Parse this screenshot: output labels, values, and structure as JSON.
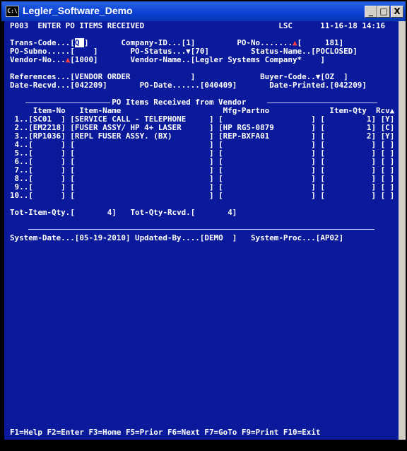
{
  "window": {
    "title": "Legler_Software_Demo",
    "icon_label": "C:\\",
    "buttons": {
      "minimize": "_",
      "maximize": "□",
      "close": "X"
    }
  },
  "header": {
    "program": "P003",
    "screen_title": "ENTER PO ITEMS RECEIVED",
    "company_code": "LSC",
    "date": "11-16-18",
    "time": "14:16"
  },
  "fields": {
    "trans_code": {
      "label": "Trans-Code...",
      "value": "Q"
    },
    "company_id": {
      "label": "Company-ID...",
      "value": "1"
    },
    "po_no": {
      "label": "PO-No........",
      "value": "181"
    },
    "po_subno": {
      "label": "PO-Subno.....",
      "value": ""
    },
    "po_status": {
      "label": "PO-Status...",
      "value": "70"
    },
    "status_name": {
      "label": "Status-Name..",
      "value": "POCLOSED"
    },
    "vendor_no": {
      "label": "Vendor-No...",
      "value": "1000"
    },
    "vendor_name": {
      "label": "Vendor-Name..",
      "value": "Legler Systems Company*"
    },
    "references": {
      "label": "References...",
      "value": "VENDOR ORDER"
    },
    "buyer_code": {
      "label": "Buyer-Code..",
      "value": "OZ"
    },
    "date_recvd": {
      "label": "Date-Recvd...",
      "value": "042209"
    },
    "po_date": {
      "label": "PO-Date......",
      "value": "040409"
    },
    "date_printed": {
      "label": "Date-Printed.",
      "value": "042209"
    }
  },
  "items_table": {
    "title": "PO Items Received from Vendor",
    "headers": {
      "item_no": "Item-No",
      "item_name": "Item-Name",
      "mfg_partno": "Mfg-Partno",
      "item_qty": "Item-Qty",
      "rcv": "Rcv"
    },
    "rows": [
      {
        "num": "1",
        "item_no": "SC01",
        "item_name": "SERVICE CALL - TELEPHONE",
        "mfg": "",
        "qty": "1",
        "rcv": "Y"
      },
      {
        "num": "2",
        "item_no": "EM2218",
        "item_name": "FUSER ASSY/ HP 4+ LASER",
        "mfg": "HP RG5-0879",
        "qty": "1",
        "rcv": "C"
      },
      {
        "num": "3",
        "item_no": "RP1036",
        "item_name": "REPL FUSER ASSY. (BX)",
        "mfg": "REP-BXFA01",
        "qty": "2",
        "rcv": "Y"
      },
      {
        "num": "4",
        "item_no": "",
        "item_name": "",
        "mfg": "",
        "qty": "",
        "rcv": ""
      },
      {
        "num": "5",
        "item_no": "",
        "item_name": "",
        "mfg": "",
        "qty": "",
        "rcv": ""
      },
      {
        "num": "6",
        "item_no": "",
        "item_name": "",
        "mfg": "",
        "qty": "",
        "rcv": ""
      },
      {
        "num": "7",
        "item_no": "",
        "item_name": "",
        "mfg": "",
        "qty": "",
        "rcv": ""
      },
      {
        "num": "8",
        "item_no": "",
        "item_name": "",
        "mfg": "",
        "qty": "",
        "rcv": ""
      },
      {
        "num": "9",
        "item_no": "",
        "item_name": "",
        "mfg": "",
        "qty": "",
        "rcv": ""
      },
      {
        "num": "10",
        "item_no": "",
        "item_name": "",
        "mfg": "",
        "qty": "",
        "rcv": ""
      }
    ]
  },
  "totals": {
    "tot_item_qty": {
      "label": "Tot-Item-Qty.",
      "value": "4"
    },
    "tot_qty_rcvd": {
      "label": "Tot-Qty-Rcvd.",
      "value": "4"
    }
  },
  "footer_fields": {
    "system_date": {
      "label": "System-Date...",
      "value": "05-19-2010"
    },
    "updated_by": {
      "label": "Updated-By....",
      "value": "DEMO"
    },
    "system_proc": {
      "label": "System-Proc...",
      "value": "AP02"
    }
  },
  "function_keys": [
    {
      "key": "F1",
      "label": "Help"
    },
    {
      "key": "F2",
      "label": "Enter"
    },
    {
      "key": "F3",
      "label": "Home"
    },
    {
      "key": "F5",
      "label": "Prior"
    },
    {
      "key": "F6",
      "label": "Next"
    },
    {
      "key": "F7",
      "label": "GoTo"
    },
    {
      "key": "F9",
      "label": "Print"
    },
    {
      "key": "F10",
      "label": "Exit"
    }
  ]
}
